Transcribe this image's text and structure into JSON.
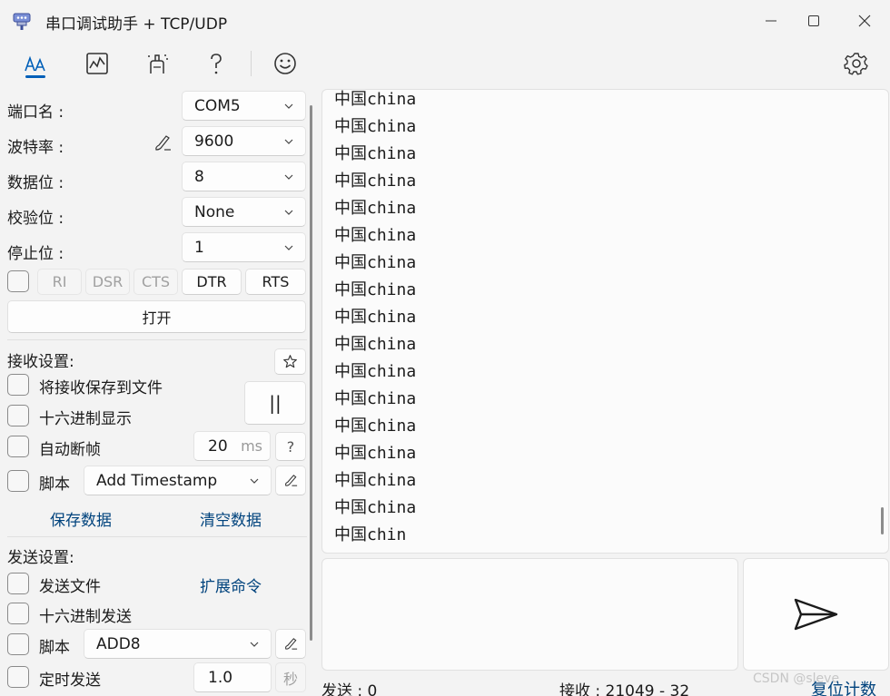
{
  "window": {
    "title": "串口调试助手 + TCP/UDP"
  },
  "toolbar": {
    "icons": [
      "font-icon",
      "chart-icon",
      "paint-icon",
      "help-icon",
      "smiley-icon",
      "gear-icon"
    ],
    "accent": "#005fb8"
  },
  "serial": {
    "port_label": "端口名 :",
    "port_value": "COM5",
    "baud_label": "波特率 :",
    "baud_value": "9600",
    "databits_label": "数据位 :",
    "databits_value": "8",
    "parity_label": "校验位 :",
    "parity_value": "None",
    "stopbits_label": "停止位 :",
    "stopbits_value": "1",
    "signals": [
      "RI",
      "DSR",
      "CTS",
      "DTR",
      "RTS"
    ],
    "open_label": "打开"
  },
  "receive": {
    "title": "接收设置:",
    "save_to_file": "将接收保存到文件",
    "hex_display": "十六进制显示",
    "auto_frame": "自动断帧",
    "frame_value": "20",
    "frame_unit": "ms",
    "frame_help": "?",
    "script_label": "脚本",
    "script_value": "Add Timestamp",
    "pause_symbol": "||",
    "save_data": "保存数据",
    "clear_data": "清空数据",
    "lines": [
      "中国china",
      "中国china",
      "中国china",
      "中国china",
      "中国china",
      "中国china",
      "中国china",
      "中国china",
      "中国china",
      "中国china",
      "中国china",
      "中国china",
      "中国china",
      "中国china",
      "中国china",
      "中国china",
      "中国chin"
    ]
  },
  "send": {
    "title": "发送设置:",
    "send_file": "发送文件",
    "ext_command": "扩展命令",
    "hex_send": "十六进制发送",
    "script_label": "脚本",
    "script_value": "ADD8",
    "timed_send": "定时发送",
    "timer_value": "1.0",
    "timer_unit": "秒"
  },
  "status": {
    "sent": "发送 : 0",
    "received": "接收 : 21049  -  32",
    "reset": "复位计数",
    "watermark": "CSDN @sleve"
  },
  "colors": {
    "link": "#00437d",
    "background": "#f3f3f3"
  }
}
